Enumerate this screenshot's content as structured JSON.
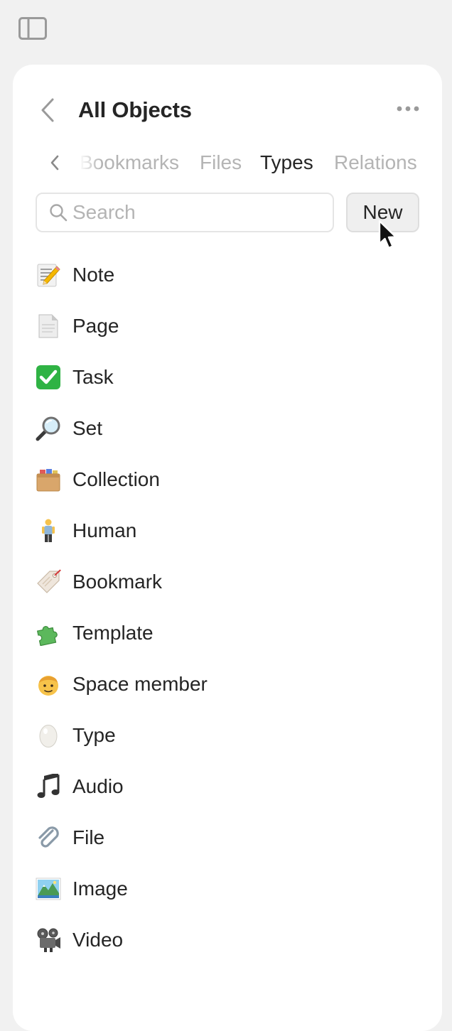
{
  "header": {
    "title": "All Objects"
  },
  "tabs": [
    {
      "label": "Bookmarks",
      "active": false
    },
    {
      "label": "Files",
      "active": false
    },
    {
      "label": "Types",
      "active": true
    },
    {
      "label": "Relations",
      "active": false
    }
  ],
  "search": {
    "placeholder": "Search",
    "value": ""
  },
  "actions": {
    "new_label": "New"
  },
  "types": [
    {
      "label": "Note",
      "icon": "memo-icon"
    },
    {
      "label": "Page",
      "icon": "page-icon"
    },
    {
      "label": "Task",
      "icon": "checkmark-box-icon"
    },
    {
      "label": "Set",
      "icon": "magnifier-icon"
    },
    {
      "label": "Collection",
      "icon": "card-file-box-icon"
    },
    {
      "label": "Human",
      "icon": "person-icon"
    },
    {
      "label": "Bookmark",
      "icon": "tag-icon"
    },
    {
      "label": "Template",
      "icon": "puzzle-piece-icon"
    },
    {
      "label": "Space member",
      "icon": "person-face-icon"
    },
    {
      "label": "Type",
      "icon": "egg-icon"
    },
    {
      "label": "Audio",
      "icon": "musical-note-icon"
    },
    {
      "label": "File",
      "icon": "paperclip-icon"
    },
    {
      "label": "Image",
      "icon": "landscape-picture-icon"
    },
    {
      "label": "Video",
      "icon": "film-projector-icon"
    }
  ],
  "colors": {
    "background": "#f1f1f1",
    "panel": "#ffffff",
    "text": "#252525",
    "muted": "#b4b4b4",
    "task_green": "#2fb344"
  }
}
